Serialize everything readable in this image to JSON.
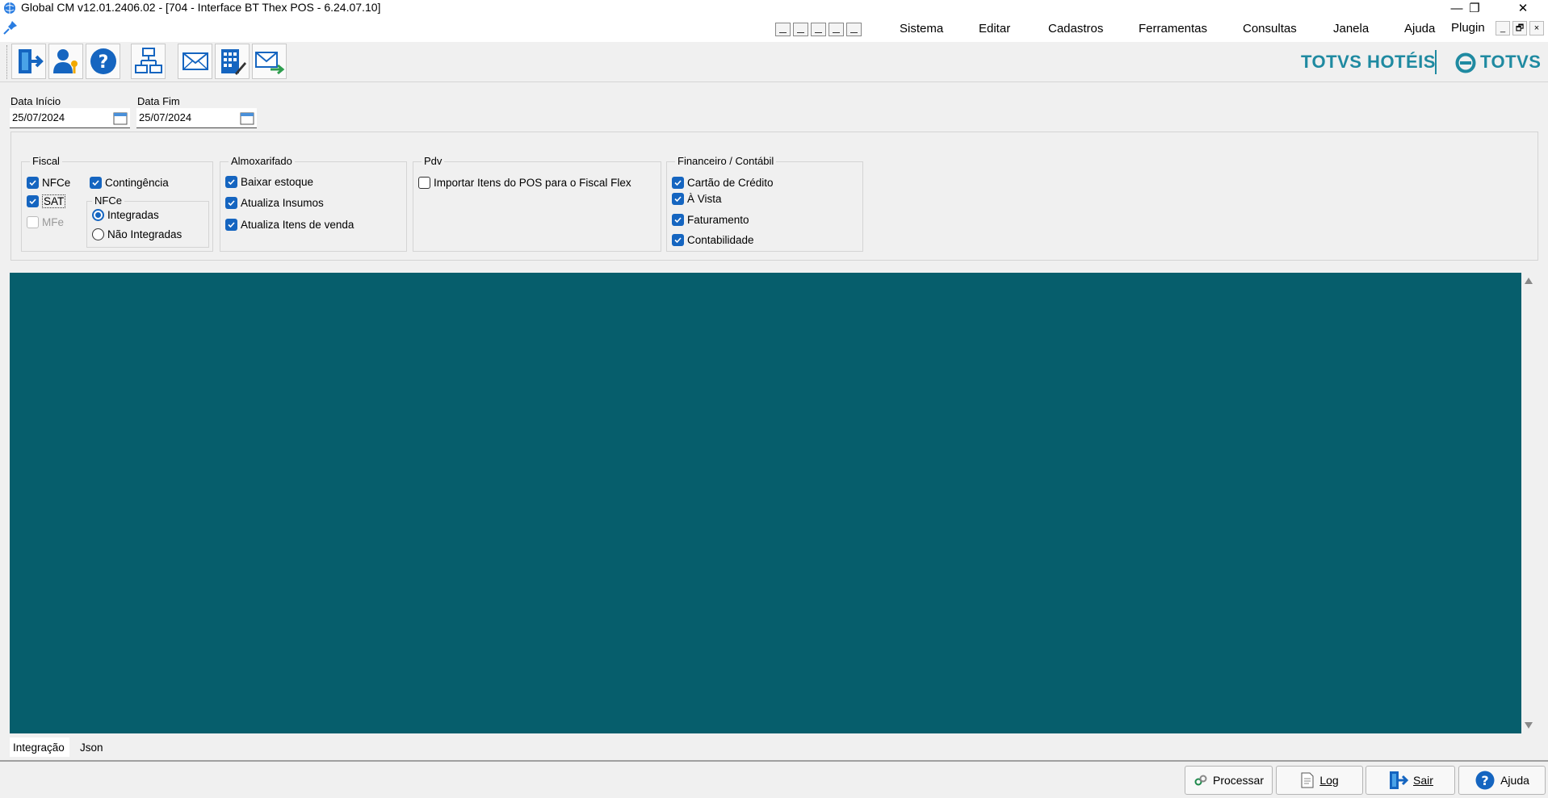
{
  "window": {
    "title": "Global CM v12.01.2406.02 - [704 - Interface BT Thex POS - 6.24.07.10]",
    "controls": {
      "minimize": "—",
      "restore": "❐",
      "close": "✕"
    }
  },
  "menu": {
    "items": [
      "Sistema",
      "Editar",
      "Cadastros",
      "Ferramentas",
      "Consultas",
      "Janela",
      "Ajuda",
      "Plugin"
    ],
    "child_controls": {
      "minimize": "_",
      "restore": "🗗",
      "close": "×"
    }
  },
  "brand": {
    "hotel": "TOTVS HOTÉIS",
    "totvs": "TOTVS",
    "color": "#1f8aa1"
  },
  "filters": {
    "start_label": "Data Início",
    "start_value": "25/07/2024",
    "end_label": "Data Fim",
    "end_value": "25/07/2024"
  },
  "fiscal": {
    "title": "Fiscal",
    "nfce": "NFCe",
    "contingencia": "Contingência",
    "sat": "SAT",
    "mfe": "MFe",
    "nfce_group": {
      "title": "NFCe",
      "integradas": "Integradas",
      "nao_integradas": "Não Integradas"
    }
  },
  "almoxarifado": {
    "title": "Almoxarifado",
    "baixar": "Baixar estoque",
    "insumos": "Atualiza Insumos",
    "itens_venda": "Atualiza Itens de venda"
  },
  "pdv": {
    "title": "Pdv",
    "importar": "Importar Itens do POS para o Fiscal Flex"
  },
  "financeiro": {
    "title": "Financeiro / Contábil",
    "cartao": "Cartão de Crédito",
    "a_vista": "À Vista",
    "faturamento": "Faturamento",
    "contabilidade": "Contabilidade"
  },
  "tabs": [
    "Integração",
    "Json"
  ],
  "footer": {
    "processar": "Processar",
    "log": "Log",
    "sair": "Sair",
    "ajuda": "Ajuda"
  },
  "colors": {
    "main_area": "#065e6c",
    "checkbox": "#1565c0"
  },
  "icons": [
    "app-globe-icon",
    "pin-icon",
    "exit-door-icon",
    "user-key-icon",
    "help-icon",
    "org-chart-icon",
    "mail-icon",
    "calculator-edit-icon",
    "mail-send-icon",
    "calendar-icon",
    "link-icon",
    "document-icon"
  ]
}
